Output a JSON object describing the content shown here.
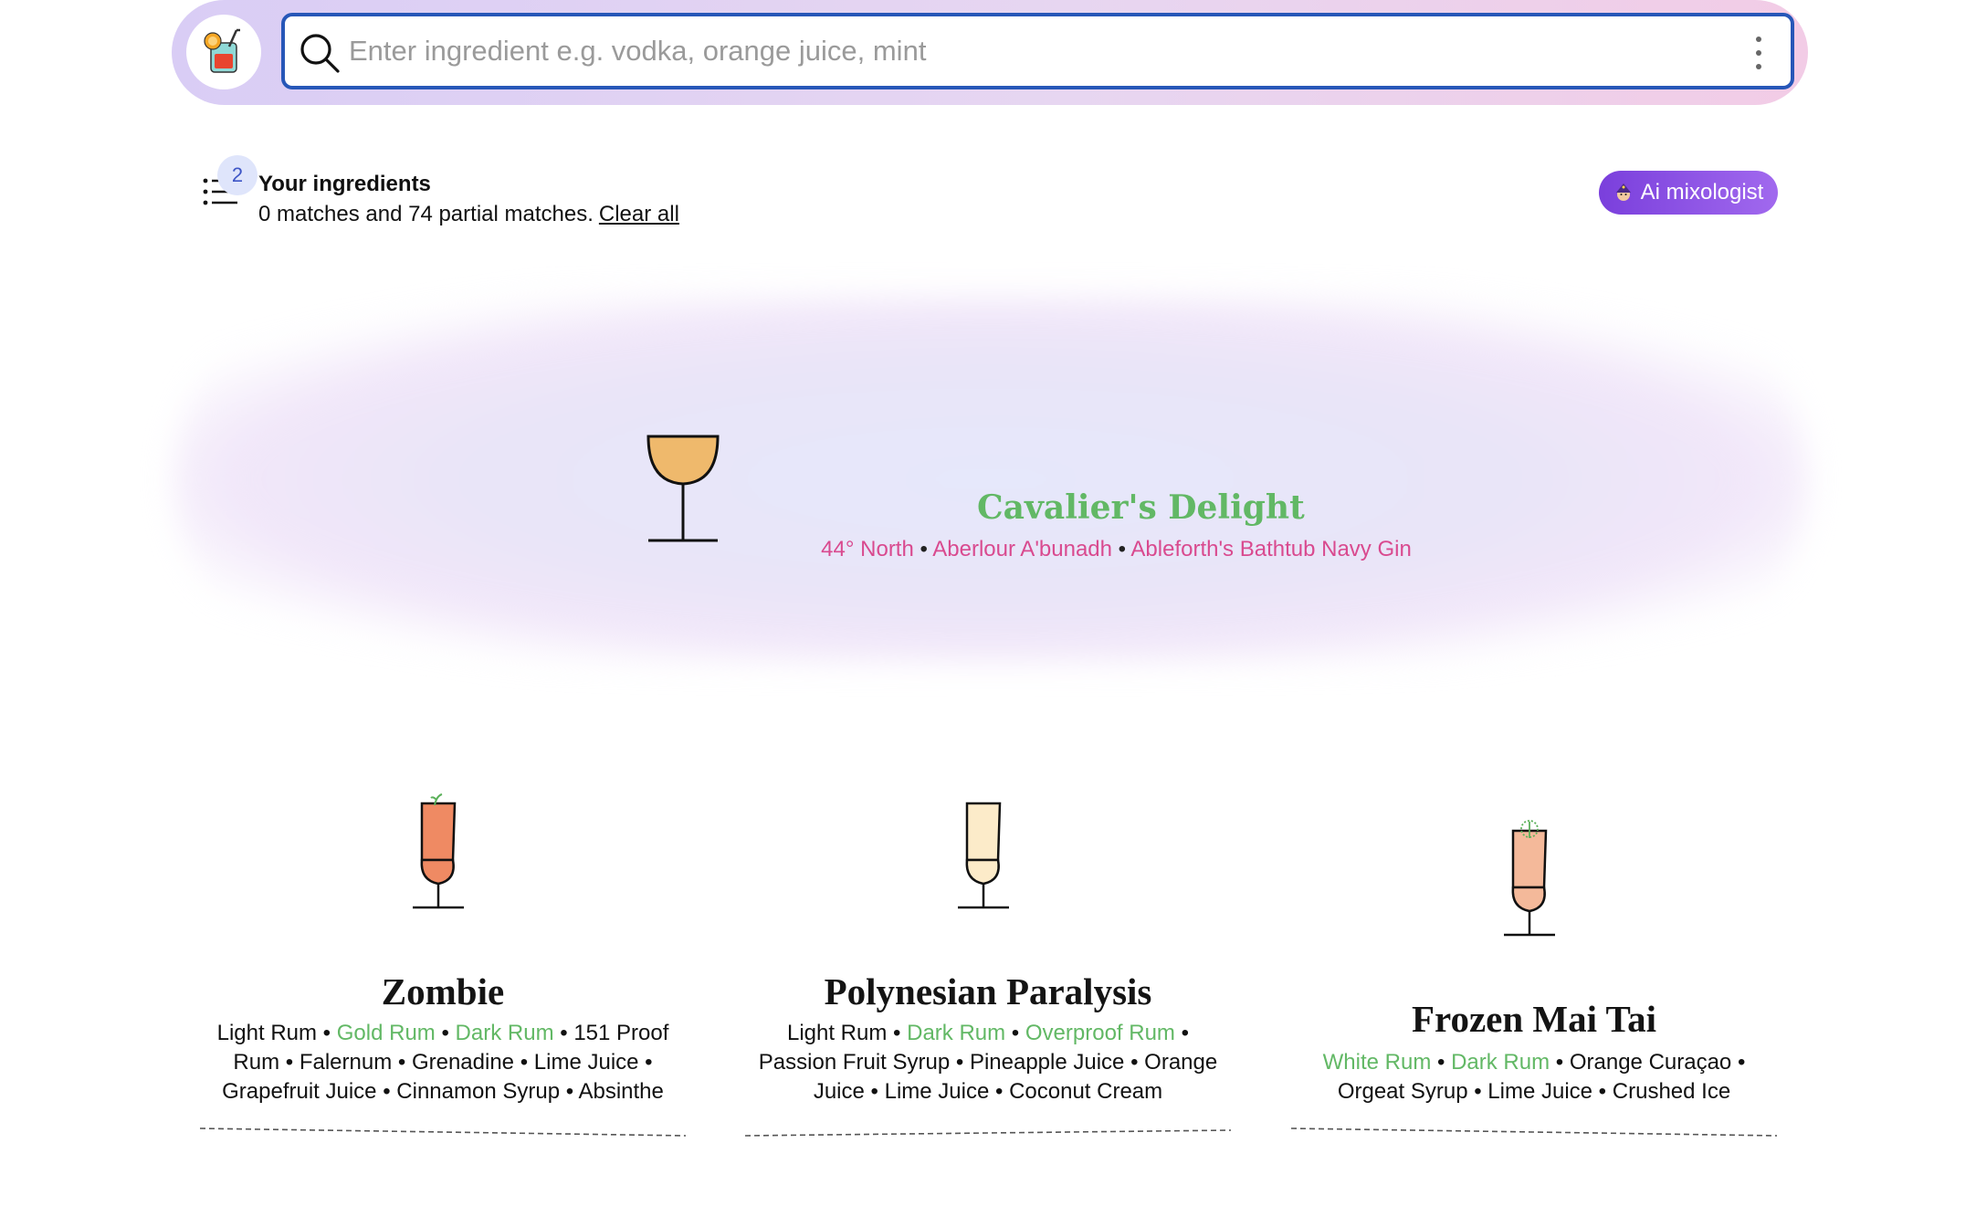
{
  "search": {
    "placeholder": "Enter ingredient e.g. vodka, orange juice, mint",
    "value": ""
  },
  "ingredients": {
    "count": "2",
    "title": "Your ingredients",
    "summary": "0 matches and 74 partial matches.",
    "clear_label": "Clear all"
  },
  "ai_button": {
    "label": "Ai mixologist"
  },
  "featured": {
    "name": "Cavalier's Delight",
    "ingredients": [
      "44° North",
      "Aberlour A'bunadh",
      "Ableforth's Bathtub Navy Gin"
    ],
    "separator": "•",
    "liquid_color": "#efb96c"
  },
  "cards": [
    {
      "name": "Zombie",
      "liquid_color": "#ef8a63",
      "ingredients": [
        {
          "text": "Light Rum",
          "matched": false
        },
        {
          "text": "Gold Rum",
          "matched": true
        },
        {
          "text": "Dark Rum",
          "matched": true
        },
        {
          "text": "151 Proof Rum",
          "matched": false
        },
        {
          "text": "Falernum",
          "matched": false
        },
        {
          "text": "Grenadine",
          "matched": false
        },
        {
          "text": "Lime Juice",
          "matched": false
        },
        {
          "text": "Grapefruit Juice",
          "matched": false
        },
        {
          "text": "Cinnamon Syrup",
          "matched": false
        },
        {
          "text": "Absinthe",
          "matched": false
        }
      ]
    },
    {
      "name": "Polynesian Paralysis",
      "liquid_color": "#fcebc9",
      "ingredients": [
        {
          "text": "Light Rum",
          "matched": false
        },
        {
          "text": "Dark Rum",
          "matched": true
        },
        {
          "text": "Overproof Rum",
          "matched": true
        },
        {
          "text": "Passion Fruit Syrup",
          "matched": false
        },
        {
          "text": "Pineapple Juice",
          "matched": false
        },
        {
          "text": "Orange Juice",
          "matched": false
        },
        {
          "text": "Lime Juice",
          "matched": false
        },
        {
          "text": "Coconut Cream",
          "matched": false
        }
      ]
    },
    {
      "name": "Frozen Mai Tai",
      "liquid_color": "#f4b99a",
      "ingredients": [
        {
          "text": "White Rum",
          "matched": true
        },
        {
          "text": "Dark Rum",
          "matched": true
        },
        {
          "text": "Orange Curaçao",
          "matched": false
        },
        {
          "text": "Orgeat Syrup",
          "matched": false
        },
        {
          "text": "Lime Juice",
          "matched": false
        },
        {
          "text": "Crushed Ice",
          "matched": false
        }
      ]
    }
  ],
  "colors": {
    "search_border": "#2757b8",
    "matched": "#62b865",
    "featured_ingredient": "#d94a8f",
    "ai_button": "#8a4fe6"
  }
}
